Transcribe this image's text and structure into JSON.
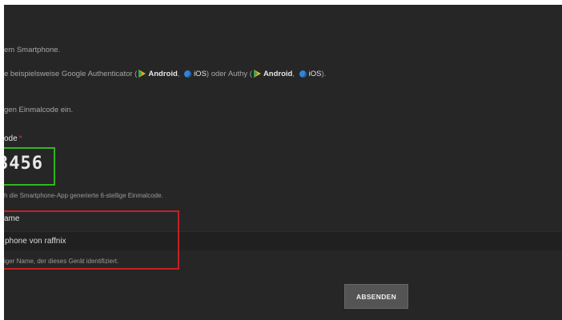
{
  "intro": {
    "line1": "em Smartphone.",
    "line2_prefix": "e beispielsweise Google Authenticator (",
    "android1": "Android",
    "sep1": ", ",
    "ios1": "iOS",
    "mid": ") oder Authy (",
    "android2": "Android",
    "sep2": ", ",
    "ios2": "iOS",
    "suffix": ").",
    "line3": "gen Einmalcode ein."
  },
  "code_field": {
    "label": "ode",
    "required_mark": "*",
    "value": "3456",
    "help": "h die Smartphone-App generierte 6-stellige Einmalcode."
  },
  "name_field": {
    "label": "ame",
    "value": "phone von raffnix",
    "help": "iger Name, der dieses Gerät identifiziert."
  },
  "submit_label": "ABSENDEN",
  "colors": {
    "background": "#262626",
    "code_highlight": "#2fb81c",
    "name_highlight": "#c52124",
    "required": "#d23a3a"
  },
  "icons": [
    "google-play-icon",
    "ios-globe-icon"
  ]
}
